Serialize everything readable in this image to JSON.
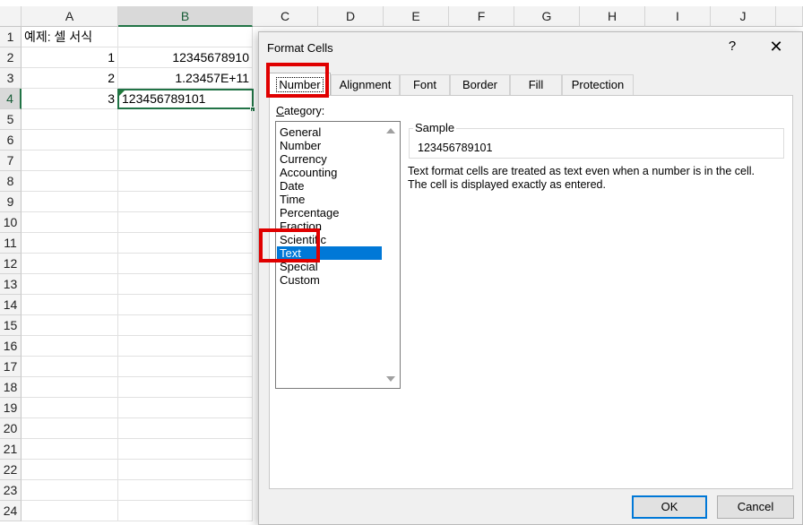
{
  "sheet": {
    "columns": [
      "A",
      "B",
      "C",
      "D",
      "E",
      "F",
      "G",
      "H",
      "I",
      "J"
    ],
    "active_column": "B",
    "rows": [
      "1",
      "2",
      "3",
      "4",
      "5",
      "6",
      "7",
      "8",
      "9",
      "10",
      "11",
      "12",
      "13",
      "14",
      "15",
      "16",
      "17",
      "18",
      "19",
      "20",
      "21",
      "22",
      "23",
      "24"
    ],
    "active_row": "4",
    "cells": {
      "A1": "예제: 셀 서식",
      "A2": "1",
      "B2": "12345678910",
      "A3": "2",
      "B3": "1.23457E+11",
      "A4": "3",
      "B4": "123456789101"
    },
    "accent_color": "#217346"
  },
  "dialog": {
    "title": "Format Cells",
    "help_label": "?",
    "close_label": "✕",
    "tabs": [
      "Number",
      "Alignment",
      "Font",
      "Border",
      "Fill",
      "Protection"
    ],
    "active_tab": "Number",
    "category_label_prefix": "C",
    "category_label_rest": "ategory:",
    "categories": [
      "General",
      "Number",
      "Currency",
      "Accounting",
      "Date",
      "Time",
      "Percentage",
      "Fraction",
      "Scientific",
      "Text",
      "Special",
      "Custom"
    ],
    "selected_category": "Text",
    "sample_label": "Sample",
    "sample_value": "123456789101",
    "description_line1": "Text format cells are treated as text even when a number is in the cell.",
    "description_line2": "The cell is displayed exactly as entered.",
    "ok_label": "OK",
    "cancel_label": "Cancel",
    "selection_color": "#0078d7",
    "highlight_color": "#e00000"
  }
}
